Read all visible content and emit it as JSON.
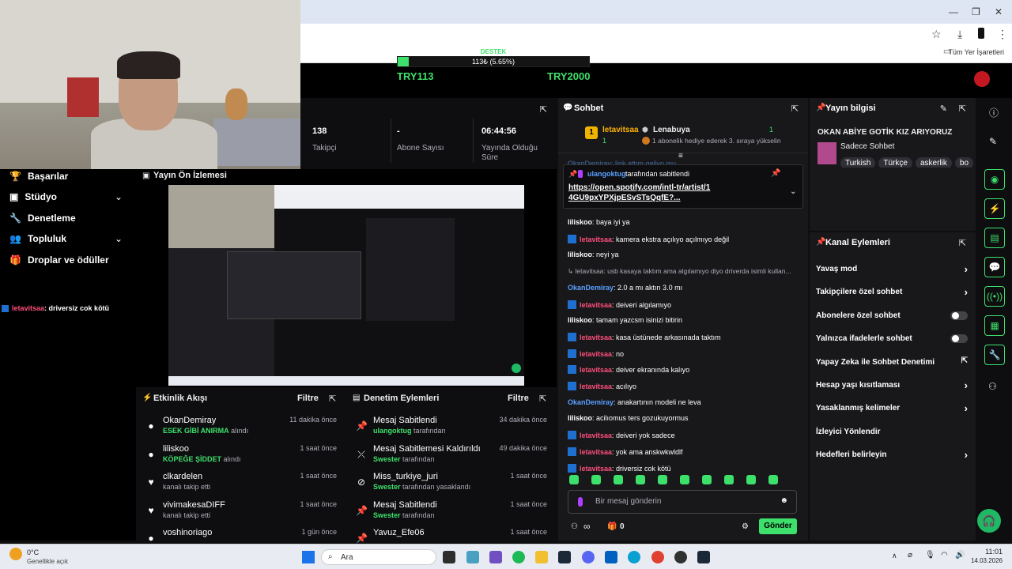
{
  "browser": {
    "bookmark": "Tüm Yer İşaretleri",
    "min": "—",
    "max": "❐",
    "close": "✕"
  },
  "goal": {
    "title": "DESTEK",
    "progress_text": "113₺ (5.65%)",
    "progress_fraction": 0.0565,
    "current": "TRY113",
    "target": "TRY2000"
  },
  "stats": [
    {
      "value": "138",
      "label": "Takipçi"
    },
    {
      "value": "-",
      "label": "Abone Sayısı"
    },
    {
      "value": "06:44:56",
      "label": "Yayında Olduğu Süre"
    }
  ],
  "nav": [
    {
      "label": "Başarılar",
      "icon": "trophy-icon"
    },
    {
      "label": "Stüdyo",
      "icon": "studio-icon",
      "chevron": true
    },
    {
      "label": "Denetleme",
      "icon": "wrench-icon"
    },
    {
      "label": "Topluluk",
      "icon": "people-icon",
      "chevron": true
    },
    {
      "label": "Droplar ve ödüller",
      "icon": "gift-icon"
    }
  ],
  "left_chat": {
    "user": "letavitsaa",
    "text": ": driversiz cok kötü"
  },
  "preview": {
    "title": "Yayın Ön İzlemesi"
  },
  "activity": {
    "title": "Etkinlik Akışı",
    "filter": "Filtre",
    "items": [
      {
        "name": "OkanDemiray",
        "highlight": "ESEK GİBİ ANIRMA",
        "sub": " alındı",
        "time": "11 dakika önce"
      },
      {
        "name": "liliskoo",
        "highlight": "KÖPEĞE ŞİDDET",
        "sub": " alındı",
        "time": "1 saat önce"
      },
      {
        "name": "clkardelen",
        "highlight": "",
        "sub": "kanalı takip etti",
        "time": "1 saat önce"
      },
      {
        "name": "vivimakesaDIFF",
        "highlight": "",
        "sub": "kanalı takip etti",
        "time": "1 saat önce"
      },
      {
        "name": "voshinoriago",
        "highlight": "",
        "sub": "",
        "time": "1 gün önce"
      }
    ]
  },
  "moderation": {
    "title": "Denetim Eylemleri",
    "filter": "Filtre",
    "items": [
      {
        "name": "Mesaj Sabitlendi",
        "highlight": "ulangoktug",
        "sub": " tarafından",
        "time": "34 dakika önce"
      },
      {
        "name": "Mesaj Sabitlemesi Kaldırıldı",
        "highlight": "Swester",
        "sub": " tarafından",
        "time": "49 dakika önce"
      },
      {
        "name": "Miss_turkiye_juri",
        "highlight": "Swester",
        "sub": " tarafından yasaklandı",
        "time": "1 saat önce"
      },
      {
        "name": "Mesaj Sabitlendi",
        "highlight": "Swester",
        "sub": " tarafından",
        "time": "1 saat önce"
      },
      {
        "name": "Yavuz_Efe06",
        "highlight": "",
        "sub": "",
        "time": "1 saat önce"
      }
    ]
  },
  "chat": {
    "title": "Sohbet",
    "rank": "1",
    "leader_user": "letavitsaa",
    "leader_count": "1",
    "gifter": "Lenabuya",
    "gifter_count": "1",
    "gifter_text": "1 abonelik hediye ederek 3. sıraya yükselin",
    "pin_by": "ulangoktug",
    "pin_suffix": " tarafından sabitlendi",
    "pin_link": "https://open.spotify.com/intl-tr/artist/14GU9pxYPXjpESvSTsQqfE?...",
    "partial_top": "OkanDemiray: link attım geliyo mu",
    "messages": [
      {
        "user": "liliskoo",
        "color": "#ffffff",
        "badge": false,
        "text": ": baya iyi ya"
      },
      {
        "user": "letavitsaa",
        "color": "#ff4f7b",
        "badge": true,
        "text": ": kamera ekstra açılıyo açılmıyo değil"
      },
      {
        "user": "liliskoo",
        "color": "#ffffff",
        "badge": false,
        "text": ": neyi ya"
      },
      {
        "user": "",
        "color": "#adadb8",
        "badge": false,
        "text": "↳ letavitsaa: usb kasaya taktım ama algılamıyo diyo driverda isimli kullan..."
      },
      {
        "user": "OkanDemiray",
        "color": "#5aa0ff",
        "badge": false,
        "text": ": 2.0 a mı aktın 3.0 mı"
      },
      {
        "user": "letavitsaa",
        "color": "#ff4f7b",
        "badge": true,
        "text": ": deiveri algılamıyo"
      },
      {
        "user": "liliskoo",
        "color": "#ffffff",
        "badge": false,
        "text": ": tamam yazcsm isinizi bitirin"
      },
      {
        "user": "letavitsaa",
        "color": "#ff4f7b",
        "badge": true,
        "text": ": kasa üstünede arkasınada taktım"
      },
      {
        "user": "letavitsaa",
        "color": "#ff4f7b",
        "badge": true,
        "text": ": no"
      },
      {
        "user": "letavitsaa",
        "color": "#ff4f7b",
        "badge": true,
        "text": ": deiver ekranında kalıyo"
      },
      {
        "user": "letavitsaa",
        "color": "#ff4f7b",
        "badge": true,
        "text": ": acılıyo"
      },
      {
        "user": "OkanDemiray",
        "color": "#5aa0ff",
        "badge": false,
        "text": ": anakartının modeli ne leva"
      },
      {
        "user": "liliskoo",
        "color": "#ffffff",
        "badge": false,
        "text": ": acilıomus ters gozukuyormus"
      },
      {
        "user": "letavitsaa",
        "color": "#ff4f7b",
        "badge": true,
        "text": ": deiveri yok sadece"
      },
      {
        "user": "letavitsaa",
        "color": "#ff4f7b",
        "badge": true,
        "text": ": yok ama anskwkwldlf"
      },
      {
        "user": "letavitsaa",
        "color": "#ff4f7b",
        "badge": true,
        "text": ": driversiz cok kötü"
      }
    ],
    "input_placeholder": "Bir mesaj gönderin",
    "points": "0",
    "infinity": "∞",
    "send": "Gönder"
  },
  "info": {
    "title": "Yayın bilgisi",
    "stream_title": "OKAN ABİYE GOTİK KIZ ARIYORUZ",
    "category": "Sadece Sohbet",
    "tags": [
      "Turkish",
      "Türkçe",
      "askerlik",
      "bo"
    ]
  },
  "actions": {
    "title": "Kanal Eylemleri",
    "rows": [
      {
        "label": "Yavaş mod",
        "kind": "chevron"
      },
      {
        "label": "Takipçilere özel sohbet",
        "kind": "chevron"
      },
      {
        "label": "Abonelere özel sohbet",
        "kind": "toggle"
      },
      {
        "label": "Yalnızca ifadelerle sohbet",
        "kind": "toggle"
      },
      {
        "label": "Yapay Zeka ile Sohbet Denetimi",
        "kind": "external"
      },
      {
        "label": "Hesap yaşı kısıtlaması",
        "kind": "chevron"
      },
      {
        "label": "Yasaklanmış kelimeler",
        "kind": "chevron"
      },
      {
        "label": "İzleyici Yönlendir",
        "kind": "none"
      },
      {
        "label": "Hedefleri belirleyin",
        "kind": "chevron"
      }
    ]
  },
  "taskbar": {
    "weather_temp": "0°C",
    "weather_text": "Genellikle açık",
    "search": "Ara",
    "time": "11:01",
    "date": "14.03.2026"
  }
}
